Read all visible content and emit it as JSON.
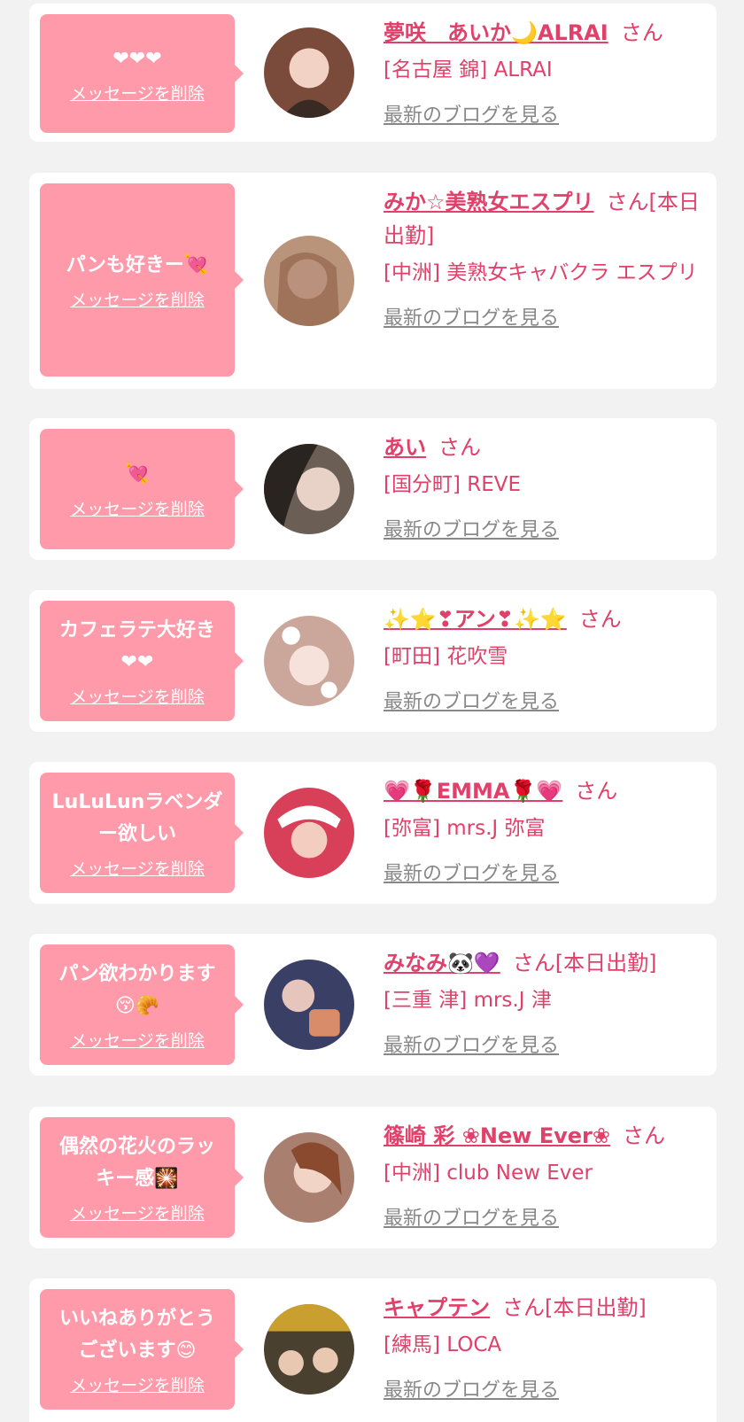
{
  "entries": [
    {
      "message": "❤❤❤",
      "delete_label": "メッセージを削除",
      "name": "夢咲　あいか🌙ALRAI",
      "suffix": "さん",
      "shop": "[名古屋 錦] ALRAI",
      "blog_label": "最新のブログを見る",
      "avatar_color": "#7a4a3a"
    },
    {
      "message": "パンも好きー💘",
      "delete_label": "メッセージを削除",
      "name": "みか☆美熟女エスプリ",
      "suffix": "さん[本日出勤]",
      "shop": "[中洲] 美熟女キャバクラ エスプリ",
      "blog_label": "最新のブログを見る",
      "avatar_color": "#b9937a"
    },
    {
      "message": "💘",
      "delete_label": "メッセージを削除",
      "name": "あい",
      "suffix": "さん",
      "shop": "[国分町] REVE",
      "blog_label": "最新のブログを見る",
      "avatar_color": "#6b5e55"
    },
    {
      "message": "カフェラテ大好き\n❤❤",
      "delete_label": "メッセージを削除",
      "name": "✨⭐❣アン❣✨⭐",
      "suffix": "さん",
      "shop": "[町田] 花吹雪",
      "blog_label": "最新のブログを見る",
      "avatar_color": "#caa79a"
    },
    {
      "message": "LuLuLunラベンダ\nー欲しい",
      "delete_label": "メッセージを削除",
      "name": "💗🌹EMMA🌹💗",
      "suffix": "さん",
      "shop": "[弥富] mrs.J 弥富",
      "blog_label": "最新のブログを見る",
      "avatar_color": "#d8405a"
    },
    {
      "message": "パン欲わかります\n😚🥐",
      "delete_label": "メッセージを削除",
      "name": "みなみ🐼💜",
      "suffix": "さん[本日出勤]",
      "shop": "[三重 津] mrs.J 津",
      "blog_label": "最新のブログを見る",
      "avatar_color": "#3a3f66"
    },
    {
      "message": "偶然の花火のラッ\nキー感🎇",
      "delete_label": "メッセージを削除",
      "name": "篠崎 彩 ❀New Ever❀",
      "suffix": "さん",
      "shop": "[中洲] club New Ever",
      "blog_label": "最新のブログを見る",
      "avatar_color": "#a98070"
    },
    {
      "message": "いいねありがとう\nございます😊",
      "delete_label": "メッセージを削除",
      "name": "キャプテン",
      "suffix": "さん[本日出勤]",
      "shop": "[練馬] LOCA",
      "blog_label": "最新のブログを見る",
      "avatar_color": "#4a4030"
    }
  ]
}
